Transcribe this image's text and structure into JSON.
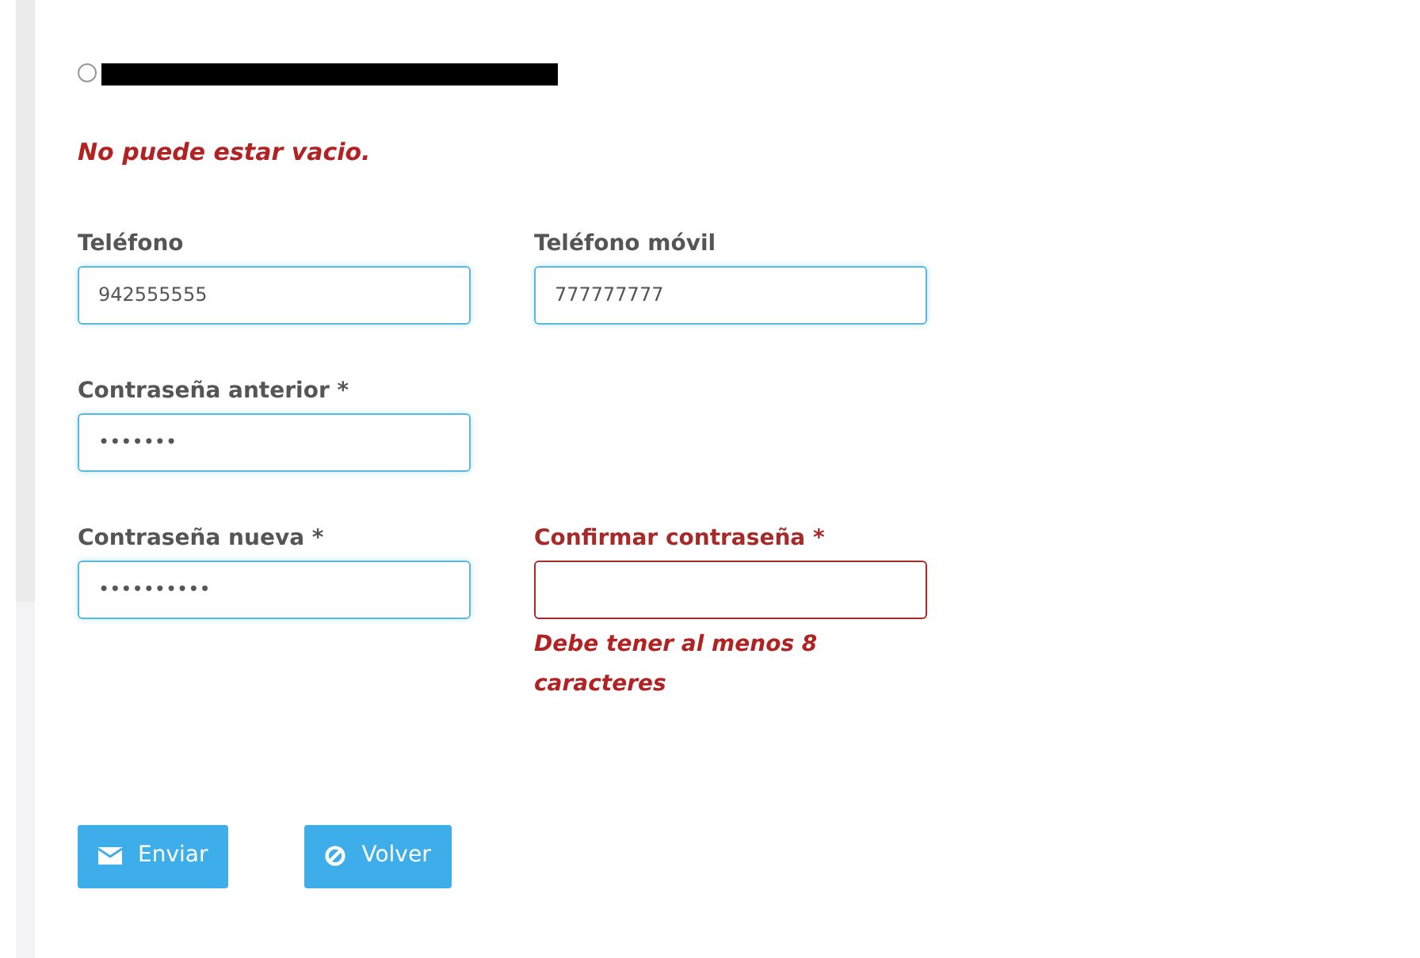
{
  "option": {
    "selected": false,
    "redacted": true
  },
  "option_error": "No puede estar vacio.",
  "field_rows": [
    {
      "fields": [
        {
          "label": "Teléfono",
          "value": "942555555",
          "error": false
        },
        {
          "label": "Teléfono móvil",
          "value": "777777777",
          "error": false
        }
      ]
    },
    {
      "fields": [
        {
          "label": "Contraseña anterior *",
          "value": "•••••••",
          "error": false
        }
      ]
    },
    {
      "fields": [
        {
          "label": "Contraseña nueva *",
          "value": "••••••••••",
          "error": false
        },
        {
          "label": "Confirmar contraseña *",
          "error": true,
          "message": "Debe tener al menos 8 caracteres"
        }
      ]
    }
  ],
  "buttons": [
    {
      "label": "Enviar",
      "kind": "send"
    },
    {
      "label": "Volver",
      "kind": "back"
    }
  ]
}
